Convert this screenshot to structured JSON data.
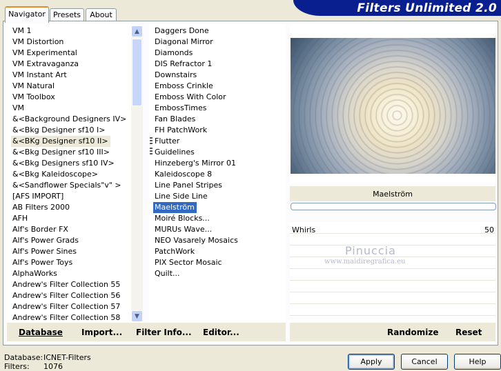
{
  "title": "Filters Unlimited 2.0",
  "tabs": [
    "Navigator",
    "Presets",
    "About"
  ],
  "categories": [
    "VM 1",
    "VM Distortion",
    "VM Experimental",
    "VM Extravaganza",
    "VM Instant Art",
    "VM Natural",
    "VM Toolbox",
    "VM",
    "&<Background Designers IV>",
    "&<Bkg Designer sf10 I>",
    "&<BKg Designer sf10 II>",
    "&<Bkg Designer sf10 III>",
    "&<Bkg Designers sf10 IV>",
    "&<Bkg Kaleidoscope>",
    "&<Sandflower Specials\"v\" >",
    "[AFS IMPORT]",
    "AB Filters 2000",
    "AFH",
    "Alf's Border FX",
    "Alf's Power Grads",
    "Alf's Power Sines",
    "Alf's Power Toys",
    "AlphaWorks",
    "Andrew's Filter Collection 55",
    "Andrew's Filter Collection 56",
    "Andrew's Filter Collection 57",
    "Andrew's Filter Collection 58"
  ],
  "selected_category": "&<BKg Designer sf10 II>",
  "filters": [
    "Daggers Done",
    "Diagonal Mirror",
    "Diamonds",
    "DIS Refractor 1",
    "Downstairs",
    "Emboss Crinkle",
    "Emboss With Color",
    "EmbossTimes",
    "Fan Blades",
    "FH PatchWork",
    "Flutter",
    "Guidelines",
    "Hinzeberg's Mirror 01",
    "Kaleidoscope 8",
    "Line Panel Stripes",
    "Line Side Line",
    "Maelström",
    "Moiré Blocks...",
    "MURUs Wave...",
    "NEO Vasarely Mosaics",
    "PatchWork",
    "PIX Sector Mosaic",
    "Quilt..."
  ],
  "selected_filter": "Maelström",
  "filter_name": "Maelström",
  "progress_fraction": 0,
  "parameters": [
    {
      "name": "Whirls",
      "value": "50"
    }
  ],
  "watermark": {
    "line1": "Pinuccia",
    "line2": "www.maidiregrafica.eu"
  },
  "left_buttons": {
    "database": "Database",
    "import": "Import...",
    "filter_info": "Filter Info...",
    "editor": "Editor..."
  },
  "right_buttons": {
    "randomize": "Randomize",
    "reset": "Reset"
  },
  "status": {
    "database_label": "Database:",
    "database_value": "ICNET-Filters",
    "filters_label": "Filters:",
    "filters_value": "1076"
  },
  "dialog_buttons": {
    "apply": "Apply",
    "cancel": "Cancel",
    "help": "Help"
  },
  "colors": {
    "banner": "#0a1f8f",
    "selection": "#316ac5",
    "window": "#ece9d8"
  }
}
